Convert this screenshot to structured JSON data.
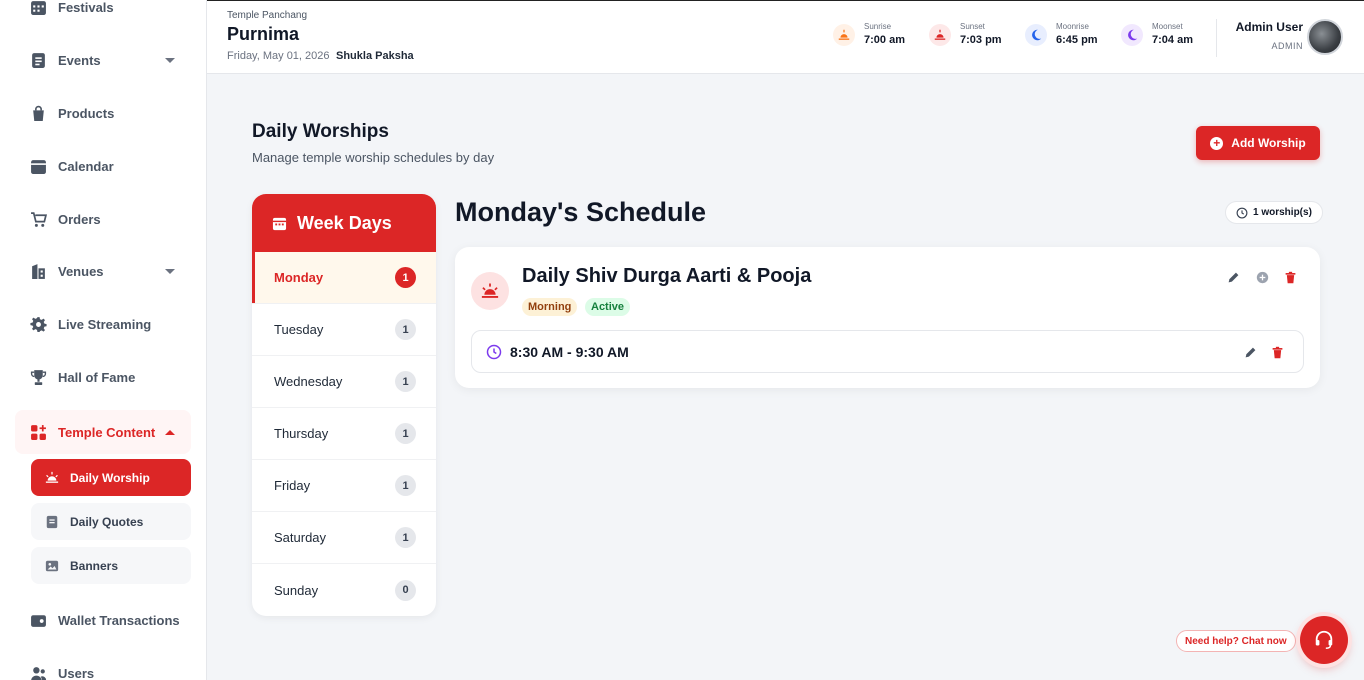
{
  "sidebar": {
    "items": [
      {
        "label": "Festivals"
      },
      {
        "label": "Events"
      },
      {
        "label": "Products"
      },
      {
        "label": "Calendar"
      },
      {
        "label": "Orders"
      },
      {
        "label": "Venues"
      },
      {
        "label": "Live Streaming"
      },
      {
        "label": "Hall of Fame"
      },
      {
        "label": "Temple Content"
      },
      {
        "label": "Wallet Transactions"
      },
      {
        "label": "Users"
      }
    ],
    "sub_items": [
      {
        "label": "Daily Worship"
      },
      {
        "label": "Daily Quotes"
      },
      {
        "label": "Banners"
      }
    ]
  },
  "header": {
    "panchang_label": "Temple Panchang",
    "tithi": "Purnima",
    "date": "Friday, May 01, 2026",
    "paksha": "Shukla Paksha",
    "astro": [
      {
        "label": "Sunrise",
        "value": "7:00 am"
      },
      {
        "label": "Sunset",
        "value": "7:03 pm"
      },
      {
        "label": "Moonrise",
        "value": "6:45 pm"
      },
      {
        "label": "Moonset",
        "value": "7:04 am"
      }
    ],
    "user_name": "Admin User",
    "user_role": "ADMIN"
  },
  "main": {
    "title": "Daily Worships",
    "subtitle": "Manage temple worship schedules by day",
    "add_label": "Add Worship",
    "week_title": "Week Days",
    "days": [
      {
        "name": "Monday",
        "count": "1"
      },
      {
        "name": "Tuesday",
        "count": "1"
      },
      {
        "name": "Wednesday",
        "count": "1"
      },
      {
        "name": "Thursday",
        "count": "1"
      },
      {
        "name": "Friday",
        "count": "1"
      },
      {
        "name": "Saturday",
        "count": "1"
      },
      {
        "name": "Sunday",
        "count": "0"
      }
    ],
    "schedule_title": "Monday's Schedule",
    "worship_count": "1 worship(s)",
    "worship": {
      "title": "Daily Shiv Durga Aarti & Pooja",
      "tag_time": "Morning",
      "tag_status": "Active",
      "time": "8:30 AM - 9:30 AM"
    }
  },
  "help": {
    "label": "Need help? Chat now"
  },
  "colors": {
    "accent": "#dc2626",
    "active_day_bg": "#fff8ec"
  }
}
